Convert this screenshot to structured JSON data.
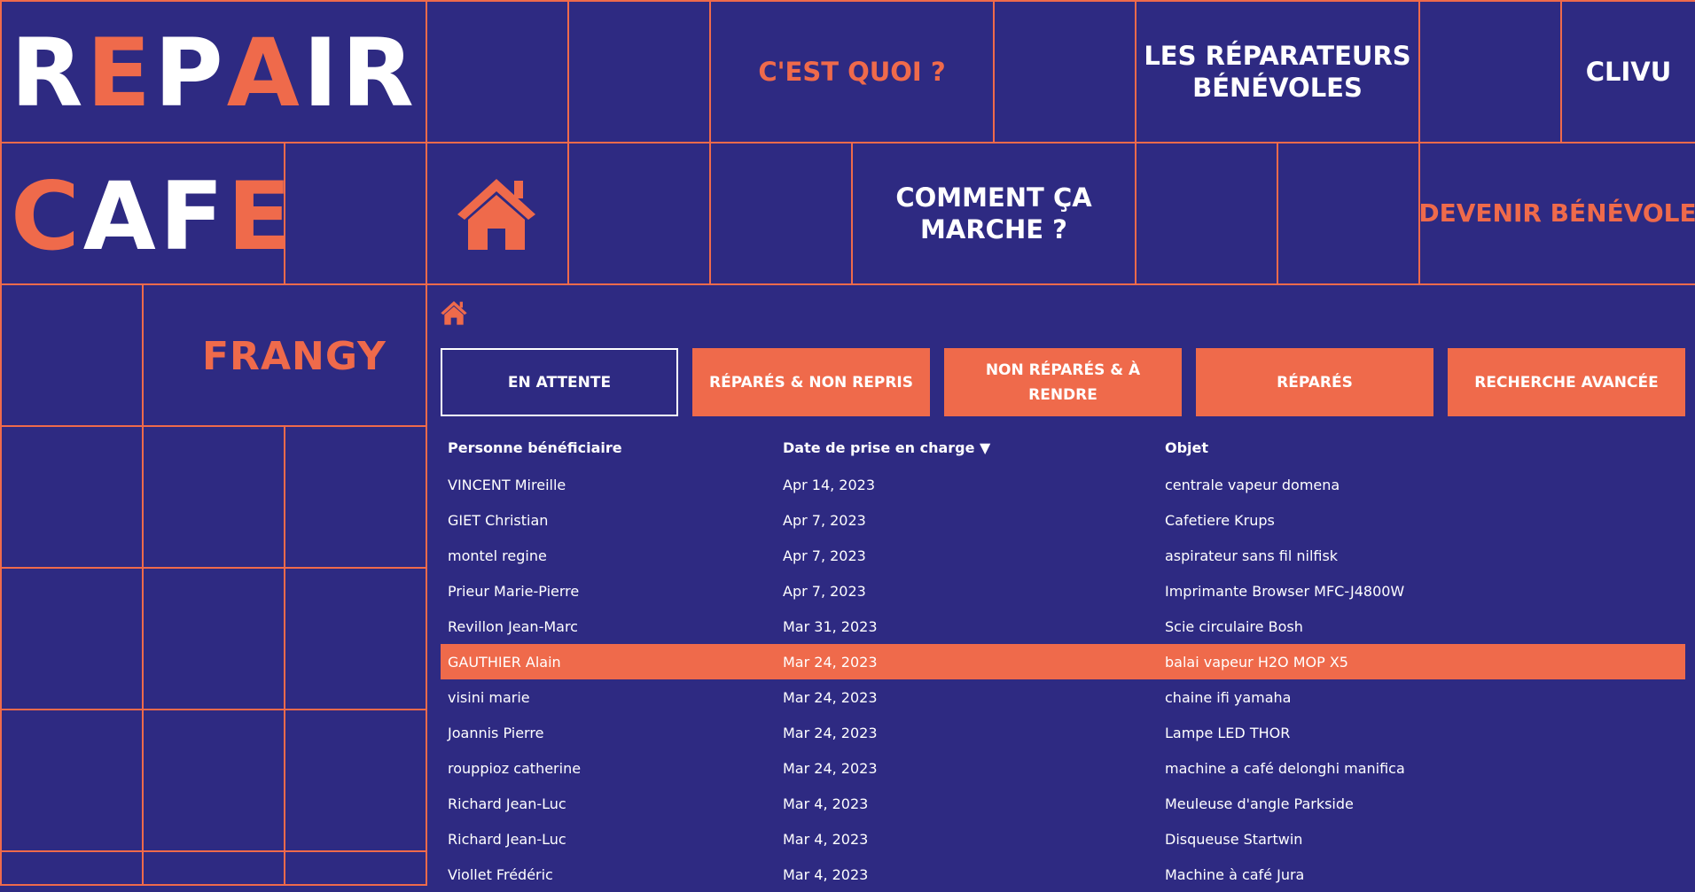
{
  "brand": {
    "line1": [
      "R",
      "E",
      "P",
      "A",
      "I",
      "R"
    ],
    "line1_colors": [
      "w",
      "o",
      "w",
      "o",
      "w",
      "w"
    ],
    "line2": [
      "C",
      "A",
      "F",
      "E"
    ],
    "line2_colors": [
      "o",
      "w",
      "w",
      "o"
    ]
  },
  "nav": {
    "cest_quoi": "C'EST QUOI ?",
    "reparateurs_line1": "LES RÉPARATEURS",
    "reparateurs_line2": "BÉNÉVOLES",
    "clivu": "CLIVU",
    "comment_line1": "COMMENT ÇA",
    "comment_line2": "MARCHE ?",
    "devenir": "DEVENIR BÉNÉVOLE"
  },
  "location": "FRANGY",
  "tabs": [
    {
      "label": "EN ATTENTE",
      "active": true
    },
    {
      "label": "RÉPARÉS & NON REPRIS",
      "active": false
    },
    {
      "label": "NON RÉPARÉS & À RENDRE",
      "active": false
    },
    {
      "label": "RÉPARÉS",
      "active": false
    },
    {
      "label": "RECHERCHE AVANCÉE",
      "active": false
    }
  ],
  "table": {
    "headers": [
      "Personne bénéficiaire",
      "Date de prise en charge ▼",
      "Objet"
    ],
    "rows": [
      [
        "VINCENT Mireille",
        "Apr 14, 2023",
        "centrale vapeur domena"
      ],
      [
        "GIET Christian",
        "Apr 7, 2023",
        "Cafetiere Krups"
      ],
      [
        "montel regine",
        "Apr 7, 2023",
        "aspirateur sans fil nilfisk"
      ],
      [
        "Prieur Marie-Pierre",
        "Apr 7, 2023",
        "Imprimante Browser MFC-J4800W"
      ],
      [
        "Revillon Jean-Marc",
        "Mar 31, 2023",
        "Scie circulaire Bosh"
      ],
      [
        "GAUTHIER Alain",
        "Mar 24, 2023",
        "balai vapeur H2O MOP X5"
      ],
      [
        "visini marie",
        "Mar 24, 2023",
        "chaine ifi yamaha"
      ],
      [
        "Joannis Pierre",
        "Mar 24, 2023",
        "Lampe LED THOR"
      ],
      [
        "rouppioz catherine",
        "Mar 24, 2023",
        "machine a café delonghi manifica"
      ],
      [
        "Richard Jean-Luc",
        "Mar 4, 2023",
        "Meuleuse d'angle Parkside"
      ],
      [
        "Richard Jean-Luc",
        "Mar 4, 2023",
        "Disqueuse Startwin"
      ],
      [
        "Viollet Frédéric",
        "Mar 4, 2023",
        "Machine à café Jura"
      ]
    ],
    "highlighted_row": 5
  },
  "colors": {
    "background": "#2e2a82",
    "accent": "#ef6a4b",
    "text": "#ffffff"
  },
  "icons": {
    "home_large": "house-icon",
    "home_small": "house-icon"
  }
}
